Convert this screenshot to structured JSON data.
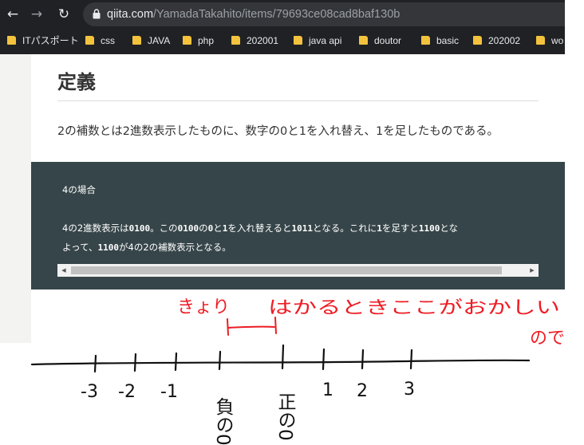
{
  "browser": {
    "url_host": "qiita.com",
    "url_path": "/YamadaTakahito/items/79693ce08cad8baf130b",
    "bookmarks": [
      "ITパスポート",
      "css",
      "JAVA",
      "php",
      "202001",
      "java api",
      "doutor",
      "basic",
      "202002",
      "wo"
    ]
  },
  "article": {
    "heading": "定義",
    "paragraph": "2の補数とは2進数表示したものに、数字の0と1を入れ替え、1を足したものである。",
    "code": {
      "line1": "4の場合",
      "line2": [
        "4の2進数表示は",
        "0100",
        "。この",
        "0100",
        "の",
        "0",
        "と",
        "1",
        "を入れ替えると",
        "1011",
        "となる。これに",
        "1",
        "を足すと",
        "1100",
        "とな"
      ],
      "line3": [
        "よって、",
        "1100",
        "が4の2の補数表示となる。"
      ]
    }
  },
  "annotations": {
    "tsumari": "きょり",
    "note_line1": "はかるときここがおかしい",
    "note_line2": "ので",
    "ticks": [
      "-3",
      "-2",
      "-1",
      "負の0",
      "正の0",
      "1",
      "2",
      "3"
    ]
  },
  "colors": {
    "ink_red": "#ee1c24",
    "ink_black": "#111111",
    "code_bg": "#364549",
    "chrome_bg": "#202124",
    "folder": "#f3c33d"
  }
}
